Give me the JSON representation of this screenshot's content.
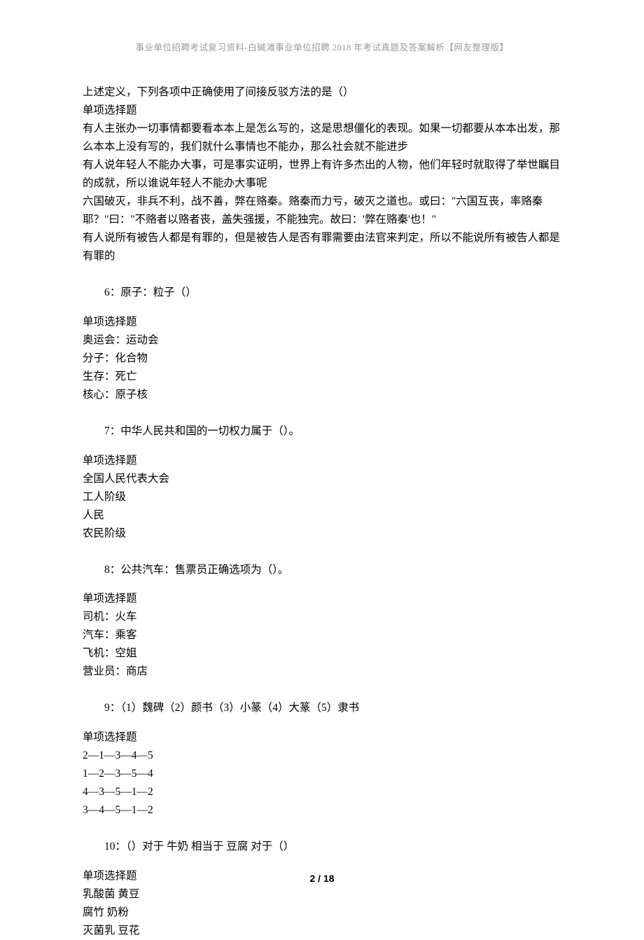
{
  "header": "事业单位招聘考试复习资料-白碱滩事业单位招聘 2018 年考试真题及答案解析【网友整理版】",
  "q5tail": {
    "stem_line": "上述定义，下列各项中正确使用了间接反驳方法的是（）",
    "type": "单项选择题",
    "options": [
      "有人主张办一切事情都要看本本上是怎么写的，这是思想僵化的表现。如果一切都要从本本出发，那么本本上没有写的，我们就什么事情也不能办，那么社会就不能进步",
      "有人说年轻人不能办大事，可是事实证明，世界上有许多杰出的人物，他们年轻时就取得了举世瞩目的成就，所以谁说年轻人不能办大事呢",
      "六国破灭，非兵不利，战不善，弊在赂秦。赂秦而力亏，破灭之道也。或曰：\"六国互丧，率赂秦耶？\"曰：\"不赂者以赂者丧，盖失强援，不能独完。故曰：'弊在赂秦'也！\"",
      "有人说所有被告人都是有罪的，但是被告人是否有罪需要由法官来判定，所以不能说所有被告人都是有罪的"
    ]
  },
  "q6": {
    "title": "6：原子：粒子（）",
    "type": "单项选择题",
    "options": [
      "奥运会：运动会",
      "分子：化合物",
      "生存：死亡",
      "核心：原子核"
    ]
  },
  "q7": {
    "title": "7：中华人民共和国的一切权力属于（）。",
    "type": "单项选择题",
    "options": [
      "全国人民代表大会",
      "工人阶级",
      "人民",
      "农民阶级"
    ]
  },
  "q8": {
    "title": "8：公共汽车：售票员正确选项为（）。",
    "type": "单项选择题",
    "options": [
      "司机：火车",
      "汽车：乘客",
      "飞机：空姐",
      "营业员：商店"
    ]
  },
  "q9": {
    "title": "9：（1）魏碑（2）颜书（3）小篆（4）大篆（5）隶书",
    "type": "单项选择题",
    "options": [
      "2—1—3—4—5",
      "1—2—3—5—4",
      "4—3—5—1—2",
      "3—4—5—1—2"
    ]
  },
  "q10": {
    "title": "10：（）对于 牛奶 相当于 豆腐 对于（）",
    "type": "单项选择题",
    "options": [
      "乳酸菌  黄豆",
      "腐竹  奶粉",
      "灭菌乳  豆花"
    ]
  },
  "footer": "2 / 18"
}
